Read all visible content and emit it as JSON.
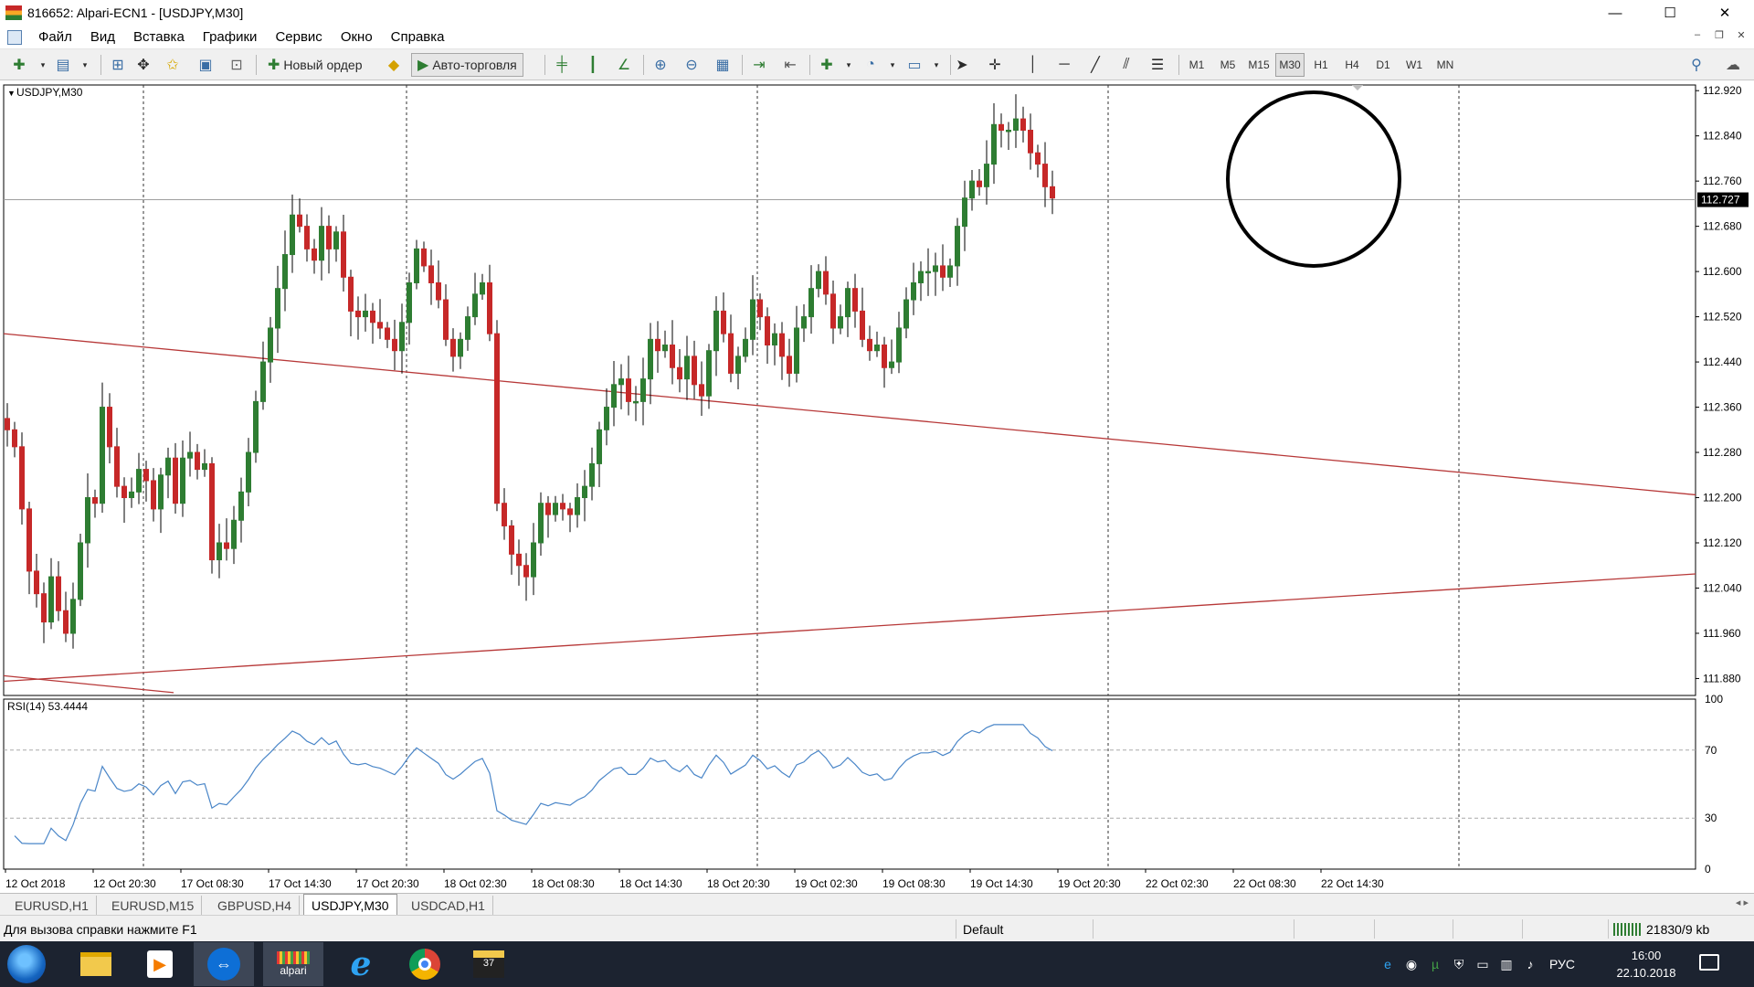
{
  "window": {
    "title": "816652: Alpari-ECN1 - [USDJPY,M30]",
    "controls": {
      "minimize": "—",
      "maximize": "☐",
      "close": "✕"
    }
  },
  "menu": {
    "items": [
      "Файл",
      "Вид",
      "Вставка",
      "Графики",
      "Сервис",
      "Окно",
      "Справка"
    ],
    "mdi": {
      "minimize": "–",
      "restore": "❐",
      "close": "✕"
    }
  },
  "toolbar": {
    "new_order": "Новый ордер",
    "auto_trading": "Авто-торговля",
    "timeframes": [
      "M1",
      "M5",
      "M15",
      "M30",
      "H1",
      "H4",
      "D1",
      "W1",
      "MN"
    ],
    "active_timeframe": "M30"
  },
  "chart": {
    "symbol_label": "USDJPY,M30",
    "rsi_label": "RSI(14) 53.4444",
    "current_price": "112.727",
    "price_ticks": [
      "112.920",
      "112.840",
      "112.760",
      "112.680",
      "112.600",
      "112.520",
      "112.440",
      "112.360",
      "112.280",
      "112.200",
      "112.120",
      "112.040",
      "111.960",
      "111.880"
    ],
    "rsi_ticks": [
      "100",
      "70",
      "30",
      "0"
    ],
    "time_ticks": [
      "12 Oct 2018",
      "12 Oct 20:30",
      "17 Oct 08:30",
      "17 Oct 14:30",
      "17 Oct 20:30",
      "18 Oct 02:30",
      "18 Oct 08:30",
      "18 Oct 14:30",
      "18 Oct 20:30",
      "19 Oct 02:30",
      "19 Oct 08:30",
      "19 Oct 14:30",
      "19 Oct 20:30",
      "22 Oct 02:30",
      "22 Oct 08:30",
      "22 Oct 14:30"
    ],
    "colors": {
      "bull": "#2e7d32",
      "bear": "#c62828",
      "trendline": "#b73838",
      "rsi": "#4a86c8",
      "grid": "#333333"
    }
  },
  "chart_data": {
    "type": "candlestick",
    "title": "USDJPY,M30",
    "ylim": [
      111.85,
      112.93
    ],
    "y_current": 112.727,
    "closes": [
      112.32,
      112.29,
      112.18,
      112.07,
      112.03,
      111.98,
      112.06,
      112.0,
      111.96,
      112.02,
      112.12,
      112.2,
      112.19,
      112.36,
      112.29,
      112.22,
      112.2,
      112.21,
      112.25,
      112.23,
      112.18,
      112.24,
      112.27,
      112.19,
      112.27,
      112.28,
      112.25,
      112.26,
      112.09,
      112.12,
      112.11,
      112.16,
      112.21,
      112.28,
      112.37,
      112.44,
      112.5,
      112.57,
      112.63,
      112.7,
      112.68,
      112.64,
      112.62,
      112.68,
      112.64,
      112.67,
      112.59,
      112.53,
      112.52,
      112.53,
      112.51,
      112.5,
      112.48,
      112.46,
      112.51,
      112.58,
      112.64,
      112.61,
      112.58,
      112.55,
      112.48,
      112.45,
      112.48,
      112.52,
      112.56,
      112.58,
      112.49,
      112.19,
      112.15,
      112.1,
      112.08,
      112.06,
      112.12,
      112.19,
      112.17,
      112.19,
      112.18,
      112.17,
      112.2,
      112.22,
      112.26,
      112.32,
      112.36,
      112.4,
      112.41,
      112.37,
      112.37,
      112.41,
      112.48,
      112.46,
      112.47,
      112.43,
      112.41,
      112.45,
      112.4,
      112.38,
      112.46,
      112.53,
      112.49,
      112.42,
      112.45,
      112.48,
      112.55,
      112.52,
      112.47,
      112.49,
      112.45,
      112.42,
      112.5,
      112.52,
      112.57,
      112.6,
      112.56,
      112.5,
      112.52,
      112.57,
      112.53,
      112.48,
      112.46,
      112.47,
      112.43,
      112.44,
      112.5,
      112.55,
      112.58,
      112.6,
      112.6,
      112.61,
      112.59,
      112.61,
      112.68,
      112.73,
      112.76,
      112.75,
      112.79,
      112.86,
      112.85,
      112.85,
      112.87,
      112.85,
      112.81,
      112.79,
      112.75,
      112.73
    ]
  },
  "symbol_tabs": {
    "items": [
      "EURUSD,H1",
      "EURUSD,M15",
      "GBPUSD,H4",
      "USDJPY,M30",
      "USDCAD,H1"
    ],
    "active": "USDJPY,M30",
    "scroll": "◂ ▸"
  },
  "status": {
    "help": "Для вызова справки нажмите F1",
    "profile": "Default",
    "traffic": "21830/9 kb"
  },
  "taskbar": {
    "tasks": [
      "explorer-icon",
      "media-player-icon",
      "teamviewer-icon",
      "alpari-icon",
      "ie-icon",
      "chrome-icon",
      "clapperboard-icon"
    ],
    "alpari_label": "alpari",
    "language": "РУС",
    "time": "16:00",
    "date": "22.10.2018"
  }
}
